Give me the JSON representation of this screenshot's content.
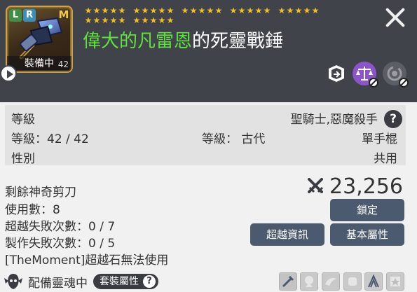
{
  "header": {
    "badges": {
      "l": "L",
      "r": "R",
      "m": "M"
    },
    "equip_label": "裝備中",
    "item_level_small": "42",
    "star_rows": [
      {
        "groups": [
          5,
          5,
          5,
          5,
          5
        ]
      },
      {
        "groups": [
          5,
          5
        ]
      }
    ],
    "item_name_prefix": "偉大的凡雷恩",
    "item_name_rest": "的死靈戰錘",
    "colors": {
      "name_prefix": "#5ee23c",
      "stars": "#f3c022",
      "header_bg": "#41434b"
    },
    "icons": [
      "share-icon",
      "compare-scale-icon",
      "transfer-cycle-icon"
    ]
  },
  "requirements": {
    "level_label": "等級",
    "job_text": "聖騎士,惡魔殺手",
    "help": "?",
    "level_line": "等級：42 / 42",
    "grade_label": "等級：  古代",
    "weapon_type": "單手棍",
    "gender_label": "性別",
    "gender_value": "共用"
  },
  "stats": {
    "scissors": "剩餘神奇剪刀",
    "uses": "使用數：8",
    "transcend_fail": "超越失敗次數：0 / 7",
    "craft_fail": "製作失敗次數：0 / 5",
    "moment": "[TheMoment]超越石無法使用"
  },
  "power": {
    "value": "23,256"
  },
  "buttons": {
    "lock": "鎖定",
    "transcend_info": "超越資訊",
    "basic_attrs": "基本屬性"
  },
  "soul": {
    "label": "配備靈魂中",
    "set_label": "套裝屬性",
    "help": "?"
  },
  "slots": [
    "weapon-slot-icon",
    "soul-slot-icon",
    "wing-slot-icon",
    "spirit-slot-icon",
    "bow-slot-icon",
    "card-slot-icon"
  ]
}
